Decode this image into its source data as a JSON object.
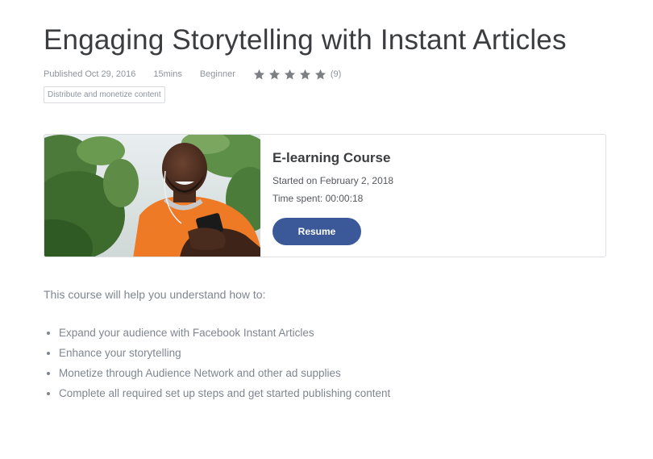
{
  "course": {
    "title": "Engaging Storytelling with Instant Articles",
    "published": "Published Oct 29, 2016",
    "duration": "15mins",
    "level": "Beginner",
    "rating_stars": 5,
    "rating_count": "(9)",
    "tag": "Distribute and monetize content"
  },
  "card": {
    "image_icon": "man-with-phone-photo",
    "type": "E-learning Course",
    "started": "Started on February 2, 2018",
    "time_spent": "Time spent: 00:00:18",
    "resume_label": "Resume"
  },
  "body": {
    "intro": "This course will help you understand how to:",
    "bullets": [
      "Expand your audience with Facebook Instant Articles",
      "Enhance your storytelling",
      "Monetize through Audience Network and other ad supplies",
      "Complete all required set up steps and get started publishing content"
    ]
  },
  "colors": {
    "primary_button": "#3b5998",
    "title": "#3b3d40",
    "muted": "#8d949e",
    "star": "#7c7f84"
  }
}
